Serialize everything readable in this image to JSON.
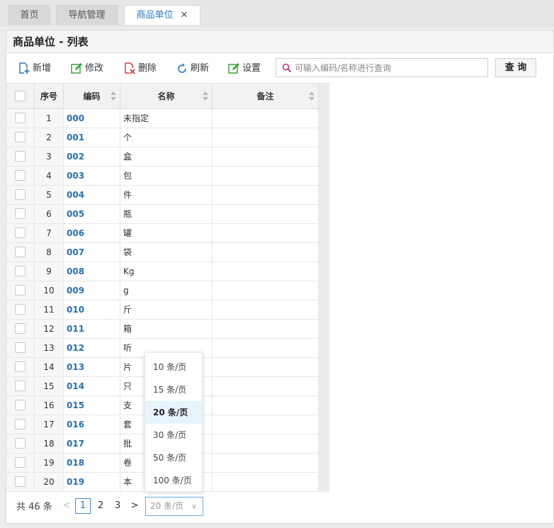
{
  "tabs": [
    {
      "label": "首页"
    },
    {
      "label": "导航管理"
    },
    {
      "label": "商品单位",
      "close": "✕"
    }
  ],
  "panel": {
    "title": "商品单位 - 列表"
  },
  "toolbar": {
    "add": "新增",
    "edit": "修改",
    "delete": "删除",
    "refresh": "刷新",
    "settings": "设置",
    "search_placeholder": "可输入编码/名称进行查询",
    "search_value": "",
    "query": "查 询"
  },
  "colors": {
    "accent": "#2a7bc0",
    "add": "#2a7bc0",
    "edit": "#3aa63a",
    "delete": "#d03a3a"
  },
  "grid": {
    "headers": {
      "seq": "序号",
      "code": "编码",
      "name": "名称",
      "remark": "备注"
    },
    "rows": [
      {
        "seq": "1",
        "code": "000",
        "name": "未指定",
        "remark": ""
      },
      {
        "seq": "2",
        "code": "001",
        "name": "个",
        "remark": ""
      },
      {
        "seq": "3",
        "code": "002",
        "name": "盒",
        "remark": ""
      },
      {
        "seq": "4",
        "code": "003",
        "name": "包",
        "remark": ""
      },
      {
        "seq": "5",
        "code": "004",
        "name": "件",
        "remark": ""
      },
      {
        "seq": "6",
        "code": "005",
        "name": "瓶",
        "remark": ""
      },
      {
        "seq": "7",
        "code": "006",
        "name": "罐",
        "remark": ""
      },
      {
        "seq": "8",
        "code": "007",
        "name": "袋",
        "remark": ""
      },
      {
        "seq": "9",
        "code": "008",
        "name": "Kg",
        "remark": ""
      },
      {
        "seq": "10",
        "code": "009",
        "name": "g",
        "remark": ""
      },
      {
        "seq": "11",
        "code": "010",
        "name": "斤",
        "remark": ""
      },
      {
        "seq": "12",
        "code": "011",
        "name": "箱",
        "remark": ""
      },
      {
        "seq": "13",
        "code": "012",
        "name": "听",
        "remark": ""
      },
      {
        "seq": "14",
        "code": "013",
        "name": "片",
        "remark": ""
      },
      {
        "seq": "15",
        "code": "014",
        "name": "只",
        "remark": ""
      },
      {
        "seq": "16",
        "code": "015",
        "name": "支",
        "remark": ""
      },
      {
        "seq": "17",
        "code": "016",
        "name": "套",
        "remark": ""
      },
      {
        "seq": "18",
        "code": "017",
        "name": "批",
        "remark": ""
      },
      {
        "seq": "19",
        "code": "018",
        "name": "卷",
        "remark": ""
      },
      {
        "seq": "20",
        "code": "019",
        "name": "本",
        "remark": ""
      }
    ]
  },
  "pager": {
    "total": "共 46 条",
    "prev": "<",
    "next": ">",
    "pages": [
      "1",
      "2",
      "3"
    ],
    "current": "1",
    "size": "20 条/页",
    "size_options": [
      "10 条/页",
      "15 条/页",
      "20 条/页",
      "30 条/页",
      "50 条/页",
      "100 条/页"
    ],
    "selected_option": "20 条/页"
  }
}
